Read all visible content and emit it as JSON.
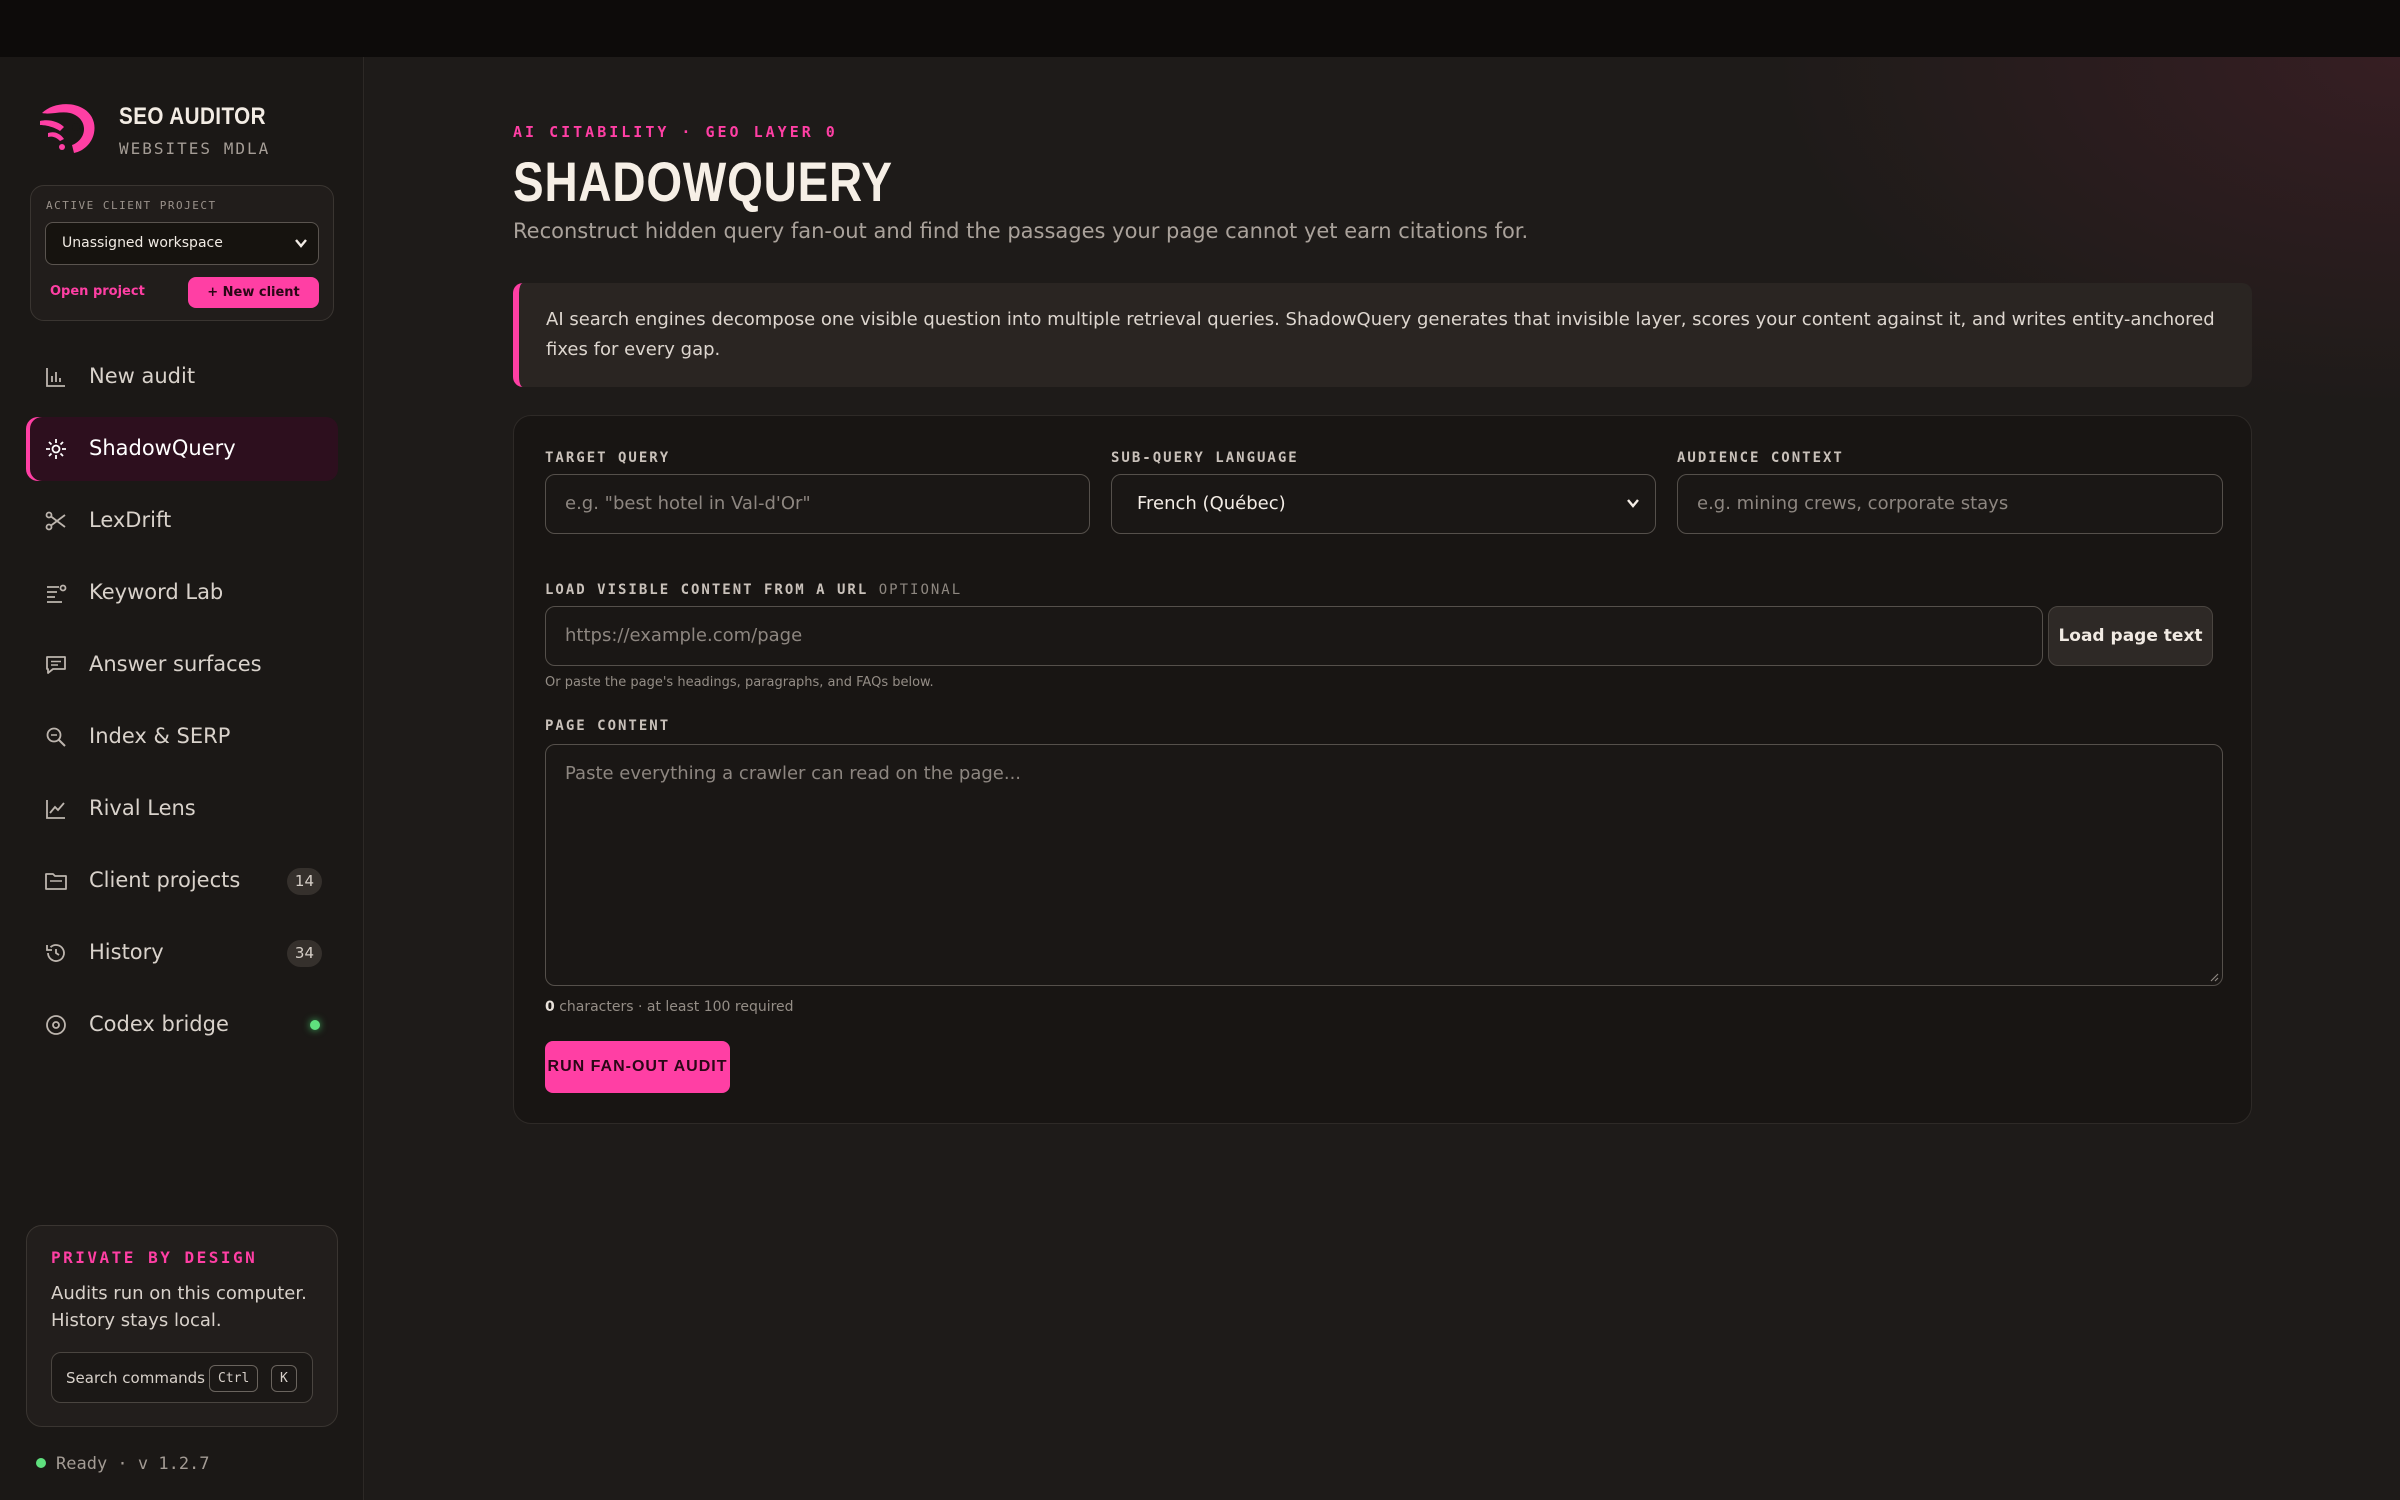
{
  "brand": {
    "title": "SEO AUDITOR",
    "subtitle": "WEBSITES MDLA"
  },
  "client": {
    "label": "ACTIVE CLIENT PROJECT",
    "selected": "Unassigned workspace",
    "open_label": "Open project",
    "new_label": "+ New client"
  },
  "nav": {
    "items": [
      {
        "label": "New audit",
        "icon": "bar-chart-icon"
      },
      {
        "label": "ShadowQuery",
        "icon": "sparkle-icon",
        "active": true
      },
      {
        "label": "LexDrift",
        "icon": "scissors-icon"
      },
      {
        "label": "Keyword Lab",
        "icon": "list-filter-icon"
      },
      {
        "label": "Answer surfaces",
        "icon": "message-icon"
      },
      {
        "label": "Index & SERP",
        "icon": "search-zoom-icon"
      },
      {
        "label": "Rival Lens",
        "icon": "line-chart-icon"
      },
      {
        "label": "Client projects",
        "icon": "folder-icon",
        "badge": "14"
      },
      {
        "label": "History",
        "icon": "history-icon",
        "badge": "34"
      },
      {
        "label": "Codex bridge",
        "icon": "gear-icon"
      }
    ]
  },
  "private": {
    "title": "PRIVATE BY DESIGN",
    "text": "Audits run on this computer. History stays local.",
    "search_label": "Search commands",
    "kbd_ctrl": "Ctrl",
    "kbd_k": "K"
  },
  "status": {
    "text": "Ready · v 1.2.7"
  },
  "page": {
    "eyebrow": "AI CITABILITY · GEO LAYER 0",
    "title": "SHADOWQUERY",
    "subtitle": "Reconstruct hidden query fan-out and find the passages your page cannot yet earn citations for.",
    "callout": "AI search engines decompose one visible question into multiple retrieval queries. ShadowQuery generates that invisible layer, scores your content against it, and writes entity-anchored fixes for every gap."
  },
  "form": {
    "target_label": "TARGET QUERY",
    "target_placeholder": "e.g. \"best hotel in Val-d'Or\"",
    "language_label": "SUB-QUERY LANGUAGE",
    "language_value": "French (Québec)",
    "audience_label": "AUDIENCE CONTEXT",
    "audience_placeholder": "e.g. mining crews, corporate stays",
    "url_label": "LOAD VISIBLE CONTENT FROM A URL",
    "url_optional": "OPTIONAL",
    "url_placeholder": "https://example.com/page",
    "load_button": "Load page text",
    "url_hint": "Or paste the page's headings, paragraphs, and FAQs below.",
    "content_label": "PAGE CONTENT",
    "content_placeholder": "Paste everything a crawler can read on the page...",
    "char_count": "0",
    "char_hint": " characters · at least 100 required",
    "run_button": "RUN FAN-OUT AUDIT"
  },
  "colors": {
    "accent": "#ff3fa4",
    "status_ok": "#5fe07e",
    "background": "#1e1b19"
  }
}
